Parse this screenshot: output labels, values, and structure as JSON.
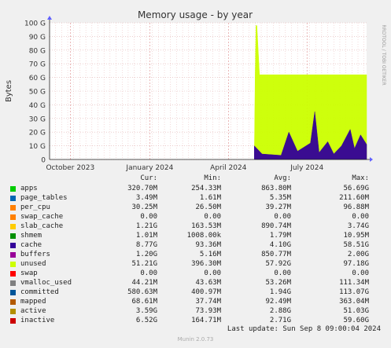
{
  "chart_data": {
    "type": "area",
    "title": "Memory usage - by year",
    "ylabel": "Bytes",
    "side_label": "RRDTOOL / TOBI OETIKER",
    "ylim": [
      0,
      100
    ],
    "y_unit": "G",
    "y_ticks": [
      "0",
      "10 G",
      "20 G",
      "30 G",
      "40 G",
      "50 G",
      "60 G",
      "70 G",
      "80 G",
      "90 G",
      "100 G"
    ],
    "x_ticks": [
      "October 2023",
      "January 2024",
      "April 2024",
      "July 2024"
    ],
    "x_tick_dates": [
      "2023-10-01",
      "2024-01-01",
      "2024-04-01",
      "2024-07-01"
    ],
    "x_range": [
      "2023-09-07",
      "2024-09-08"
    ],
    "grid": true,
    "series": [
      {
        "name": "unused",
        "color": "#ccff00",
        "x": [
          "2024-05-01",
          "2024-05-02",
          "2024-05-03",
          "2024-05-04",
          "2024-05-07",
          "2024-05-10",
          "2024-09-08"
        ],
        "values": [
          0,
          62,
          98,
          98,
          62,
          62,
          62
        ]
      },
      {
        "name": "cache",
        "color": "#330099",
        "x": [
          "2024-05-01",
          "2024-05-10",
          "2024-06-01",
          "2024-06-10",
          "2024-06-20",
          "2024-07-05",
          "2024-07-10",
          "2024-07-15",
          "2024-07-25",
          "2024-08-01",
          "2024-08-10",
          "2024-08-20",
          "2024-08-25",
          "2024-09-01",
          "2024-09-08"
        ],
        "values": [
          10,
          4,
          3,
          20,
          6,
          12,
          35,
          5,
          13,
          4,
          10,
          22,
          8,
          18,
          11
        ]
      }
    ]
  },
  "legend": {
    "headers": {
      "cur": "Cur:",
      "min": "Min:",
      "avg": "Avg:",
      "max": "Max:"
    },
    "rows": [
      {
        "name": "apps",
        "color": "#00cc00",
        "cur": "320.70M",
        "min": "254.33M",
        "avg": "863.80M",
        "max": "56.69G"
      },
      {
        "name": "page_tables",
        "color": "#0066b3",
        "cur": "3.49M",
        "min": "1.61M",
        "avg": "5.35M",
        "max": "211.60M"
      },
      {
        "name": "per_cpu",
        "color": "#ff8000",
        "cur": "30.25M",
        "min": "26.50M",
        "avg": "39.27M",
        "max": "96.88M"
      },
      {
        "name": "swap_cache",
        "color": "#ff8000",
        "cur": "0.00",
        "min": "0.00",
        "avg": "0.00",
        "max": "0.00"
      },
      {
        "name": "slab_cache",
        "color": "#ffcc00",
        "cur": "1.21G",
        "min": "163.53M",
        "avg": "890.74M",
        "max": "3.74G"
      },
      {
        "name": "shmem",
        "color": "#008f00",
        "cur": "1.01M",
        "min": "1008.00k",
        "avg": "1.79M",
        "max": "10.95M"
      },
      {
        "name": "cache",
        "color": "#330099",
        "cur": "8.77G",
        "min": "93.36M",
        "avg": "4.10G",
        "max": "58.51G"
      },
      {
        "name": "buffers",
        "color": "#990099",
        "cur": "1.20G",
        "min": "5.16M",
        "avg": "850.77M",
        "max": "2.00G"
      },
      {
        "name": "unused",
        "color": "#ccff00",
        "cur": "51.21G",
        "min": "396.30M",
        "avg": "57.92G",
        "max": "97.18G"
      },
      {
        "name": "swap",
        "color": "#ff0000",
        "cur": "0.00",
        "min": "0.00",
        "avg": "0.00",
        "max": "0.00"
      },
      {
        "name": "vmalloc_used",
        "color": "#808080",
        "cur": "44.21M",
        "min": "43.63M",
        "avg": "53.26M",
        "max": "111.34M"
      },
      {
        "name": "committed",
        "color": "#005599",
        "cur": "580.63M",
        "min": "400.97M",
        "avg": "1.94G",
        "max": "113.07G"
      },
      {
        "name": "mapped",
        "color": "#b35a00",
        "cur": "68.61M",
        "min": "37.74M",
        "avg": "92.49M",
        "max": "363.04M"
      },
      {
        "name": "active",
        "color": "#b38f00",
        "cur": "3.59G",
        "min": "73.93M",
        "avg": "2.88G",
        "max": "51.03G"
      },
      {
        "name": "inactive",
        "color": "#cc0000",
        "cur": "6.52G",
        "min": "164.71M",
        "avg": "2.71G",
        "max": "59.60G"
      }
    ],
    "last_update": "Last update:  Sun Sep  8 09:00:04 2024"
  },
  "footer": "Munin 2.0.73"
}
